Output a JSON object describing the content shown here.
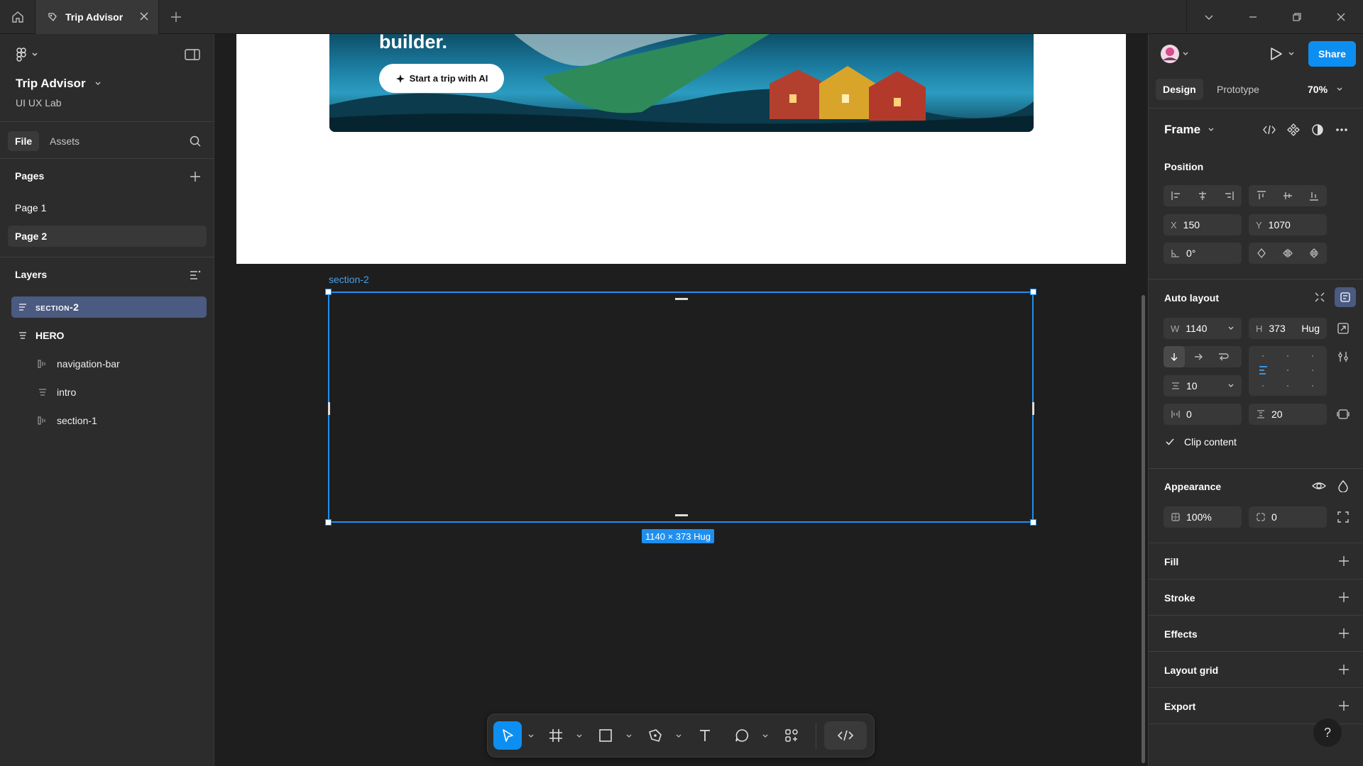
{
  "tabbar": {
    "active_tab": "Trip Advisor"
  },
  "left": {
    "project_title": "Trip Advisor",
    "project_subtitle": "UI UX Lab",
    "tabs": [
      "File",
      "Assets"
    ],
    "pages_title": "Pages",
    "pages": [
      "Page 1",
      "Page 2"
    ],
    "layers_title": "Layers",
    "layers": [
      {
        "label": "section-2",
        "selected": true
      },
      {
        "label": "HERO"
      },
      {
        "label": "navigation-bar"
      },
      {
        "label": "intro"
      },
      {
        "label": "section-1"
      }
    ]
  },
  "canvas": {
    "hero_heading": "builder.",
    "hero_button": "Start a trip with AI",
    "selection_label": "section-2",
    "size_badge": "1140 × 373 Hug"
  },
  "right": {
    "share_label": "Share",
    "tabs": [
      "Design",
      "Prototype"
    ],
    "zoom": "70%",
    "frame_label": "Frame",
    "position_title": "Position",
    "x": {
      "label": "X",
      "value": "150"
    },
    "y": {
      "label": "Y",
      "value": "1070"
    },
    "rotation": "0°",
    "auto_layout_title": "Auto layout",
    "w": {
      "label": "W",
      "value": "1140"
    },
    "h": {
      "label": "H",
      "value": "373",
      "mode": "Hug"
    },
    "gap": "10",
    "padding_h": "0",
    "padding_v": "20",
    "clip_content": "Clip content",
    "appearance_title": "Appearance",
    "opacity": "100%",
    "radius": "0",
    "fill": "Fill",
    "stroke": "Stroke",
    "effects": "Effects",
    "layout_grid": "Layout grid",
    "export": "Export",
    "help": "?"
  },
  "colors": {
    "accent": "#0d8ff2",
    "panel": "#2c2c2c",
    "canvas": "#1e1e1e",
    "selected_layer": "#4a5a80"
  }
}
